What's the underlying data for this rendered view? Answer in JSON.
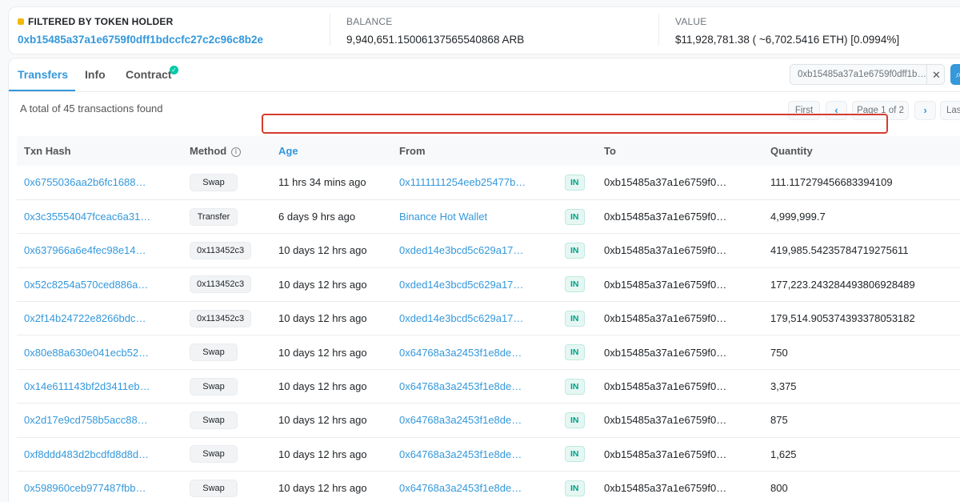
{
  "summary": {
    "filter_label": "FILTERED BY TOKEN HOLDER",
    "holder_address": "0xb15485a37a1e6759f0dff1bdccfc27c2c96c8b2e",
    "balance_label": "BALANCE",
    "balance_value": "9,940,651.15006137565540868 ARB",
    "value_label": "VALUE",
    "value_value": "$11,928,781.38 ( ~6,702.5416 ETH) [0.0994%]"
  },
  "tabs": [
    {
      "label": "Transfers",
      "active": true
    },
    {
      "label": "Info",
      "active": false
    },
    {
      "label": "Contract",
      "active": false
    }
  ],
  "filter": {
    "value": "0xb15485a37a1e6759f0dff1b…",
    "close": "✕"
  },
  "total_text": "A total of 45 transactions found",
  "pagination": {
    "first": "First",
    "prev": "‹",
    "page": "Page 1 of 2",
    "next": "›",
    "last": "Last"
  },
  "table": {
    "headers": {
      "hash": "Txn Hash",
      "method": "Method",
      "age": "Age",
      "from": "From",
      "to": "To",
      "quantity": "Quantity"
    },
    "direction_label": "IN",
    "rows": [
      {
        "hash": "0x6755036aa2b6fc1688…",
        "method": "Swap",
        "age": "11 hrs 34 mins ago",
        "from": "0x1111111254eeb25477b…",
        "to": "0xb15485a37a1e6759f0…",
        "quantity": "111.117279456683394109"
      },
      {
        "hash": "0x3c35554047fceac6a31…",
        "method": "Transfer",
        "age": "6 days 9 hrs ago",
        "from": "Binance Hot Wallet",
        "to": "0xb15485a37a1e6759f0…",
        "quantity": "4,999,999.7"
      },
      {
        "hash": "0x637966a6e4fec98e14…",
        "method": "0x113452c3",
        "age": "10 days 12 hrs ago",
        "from": "0xded14e3bcd5c629a17…",
        "to": "0xb15485a37a1e6759f0…",
        "quantity": "419,985.54235784719275611"
      },
      {
        "hash": "0x52c8254a570ced886a…",
        "method": "0x113452c3",
        "age": "10 days 12 hrs ago",
        "from": "0xded14e3bcd5c629a17…",
        "to": "0xb15485a37a1e6759f0…",
        "quantity": "177,223.243284493806928489"
      },
      {
        "hash": "0x2f14b24722e8266bdc…",
        "method": "0x113452c3",
        "age": "10 days 12 hrs ago",
        "from": "0xded14e3bcd5c629a17…",
        "to": "0xb15485a37a1e6759f0…",
        "quantity": "179,514.905374393378053182"
      },
      {
        "hash": "0x80e88a630e041ecb52…",
        "method": "Swap",
        "age": "10 days 12 hrs ago",
        "from": "0x64768a3a2453f1e8de…",
        "to": "0xb15485a37a1e6759f0…",
        "quantity": "750"
      },
      {
        "hash": "0x14e611143bf2d3411eb…",
        "method": "Swap",
        "age": "10 days 12 hrs ago",
        "from": "0x64768a3a2453f1e8de…",
        "to": "0xb15485a37a1e6759f0…",
        "quantity": "3,375"
      },
      {
        "hash": "0x2d17e9cd758b5acc88…",
        "method": "Swap",
        "age": "10 days 12 hrs ago",
        "from": "0x64768a3a2453f1e8de…",
        "to": "0xb15485a37a1e6759f0…",
        "quantity": "875"
      },
      {
        "hash": "0xf8ddd483d2bcdfd8d8d…",
        "method": "Swap",
        "age": "10 days 12 hrs ago",
        "from": "0x64768a3a2453f1e8de…",
        "to": "0xb15485a37a1e6759f0…",
        "quantity": "1,625"
      },
      {
        "hash": "0x598960ceb977487fbb…",
        "method": "Swap",
        "age": "10 days 12 hrs ago",
        "from": "0x64768a3a2453f1e8de…",
        "to": "0xb15485a37a1e6759f0…",
        "quantity": "800"
      }
    ]
  },
  "colors": {
    "accent": "#3498db",
    "in_badge": "#00a186",
    "highlight": "#d63c2f"
  }
}
